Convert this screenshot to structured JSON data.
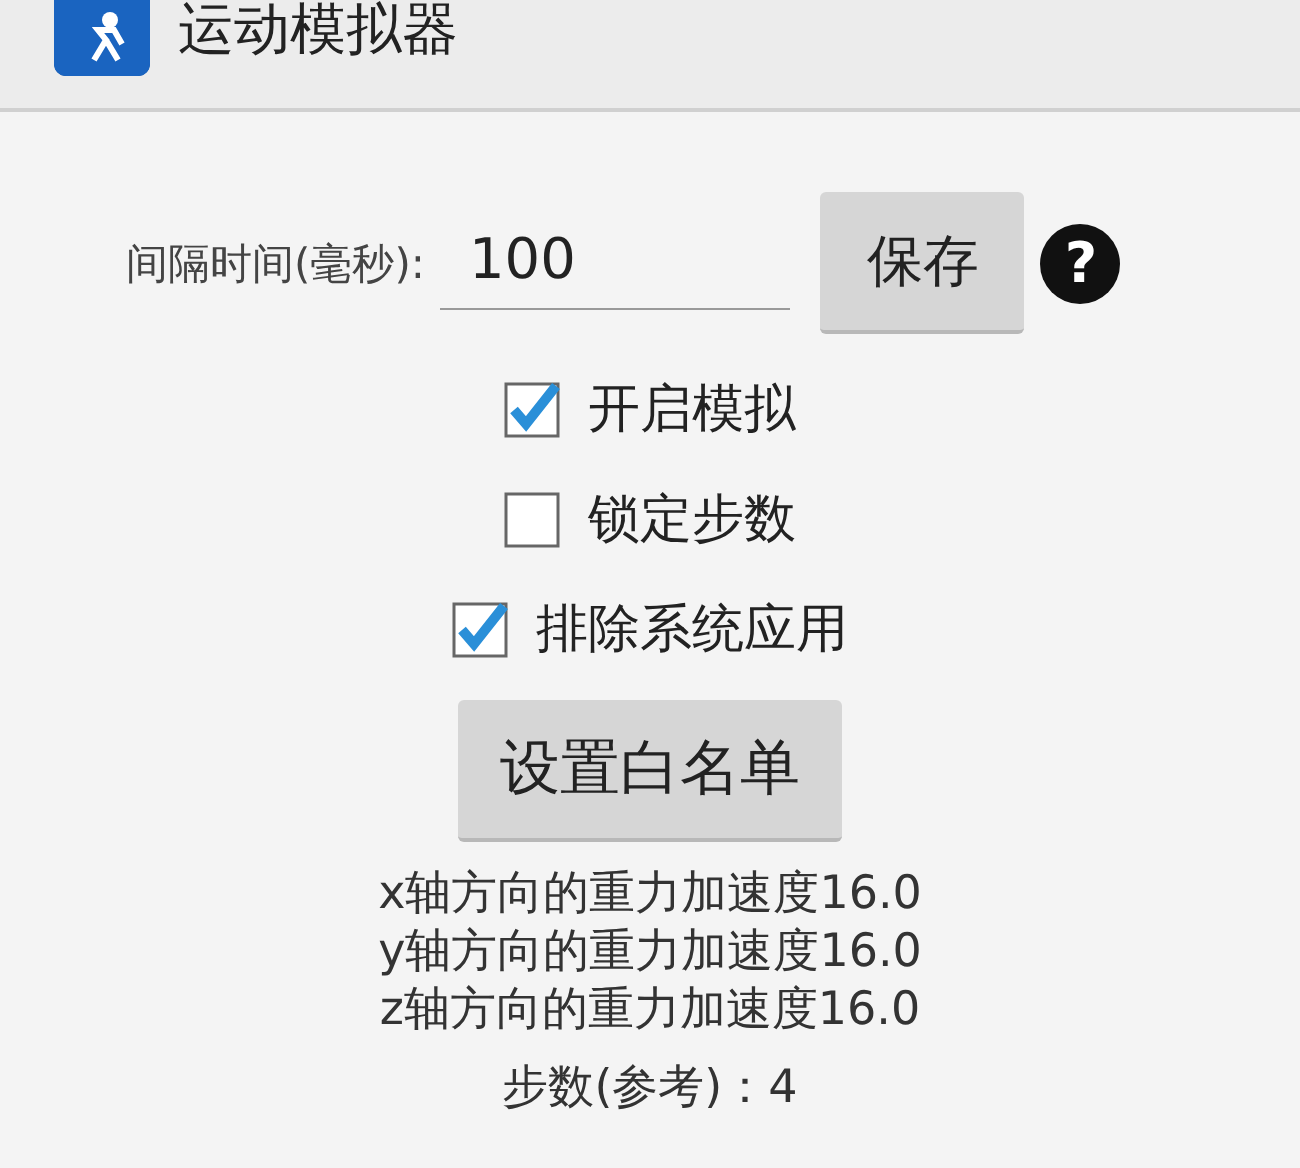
{
  "window": {
    "title": "运动模拟器"
  },
  "interval": {
    "label": "间隔时间(毫秒):",
    "value": "100",
    "save_button": "保存",
    "help": "?"
  },
  "options": [
    {
      "label": "开启模拟",
      "checked": true
    },
    {
      "label": "锁定步数",
      "checked": false
    },
    {
      "label": "排除系统应用",
      "checked": true
    }
  ],
  "whitelist_button": "设置白名单",
  "readings": [
    "x轴方向的重力加速度16.0",
    "y轴方向的重力加速度16.0",
    "z轴方向的重力加速度16.0"
  ],
  "steps": "步数(参考)：4"
}
